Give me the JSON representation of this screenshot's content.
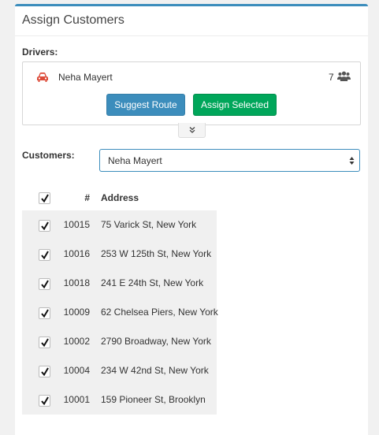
{
  "panel": {
    "title": "Assign Customers"
  },
  "drivers": {
    "label": "Drivers:",
    "items": [
      {
        "name": "Neha Mayert",
        "count": "7",
        "icon": "car-icon",
        "count_icon": "users-icon"
      }
    ],
    "suggest_label": "Suggest Route",
    "assign_label": "Assign Selected",
    "toggle_icon": "chevron-double-down-icon"
  },
  "customers": {
    "label": "Customers:",
    "selected": "Neha Mayert",
    "table": {
      "headers": {
        "select_all_checked": true,
        "number": "#",
        "address": "Address"
      },
      "rows": [
        {
          "checked": true,
          "number": "10015",
          "address": "75 Varick St, New York"
        },
        {
          "checked": true,
          "number": "10016",
          "address": "253 W 125th St, New York"
        },
        {
          "checked": true,
          "number": "10018",
          "address": "241 E 24th St, New York"
        },
        {
          "checked": true,
          "number": "10009",
          "address": "62 Chelsea Piers, New York"
        },
        {
          "checked": true,
          "number": "10002",
          "address": "2790 Broadway, New York"
        },
        {
          "checked": true,
          "number": "10004",
          "address": "234 W 42nd St, New York"
        },
        {
          "checked": true,
          "number": "10001",
          "address": "159 Pioneer St, Brooklyn"
        }
      ]
    }
  },
  "colors": {
    "primary": "#3c8dbc",
    "success": "#00a65a",
    "danger": "#dd4b39"
  }
}
